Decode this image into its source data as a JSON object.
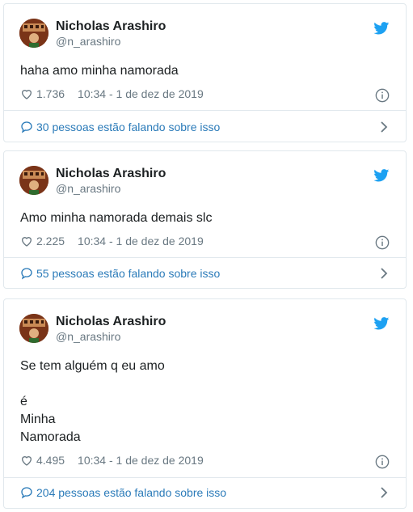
{
  "tweets": [
    {
      "name": "Nicholas Arashiro",
      "handle": "@n_arashiro",
      "lines": [
        "haha amo minha namorada"
      ],
      "likes": "1.736",
      "timestamp": "10:34 - 1 de dez de 2019",
      "conversation": "30 pessoas estão falando sobre isso"
    },
    {
      "name": "Nicholas Arashiro",
      "handle": "@n_arashiro",
      "lines": [
        "Amo minha namorada demais slc"
      ],
      "likes": "2.225",
      "timestamp": "10:34 - 1 de dez de 2019",
      "conversation": "55 pessoas estão falando sobre isso"
    },
    {
      "name": "Nicholas Arashiro",
      "handle": "@n_arashiro",
      "lines": [
        "Se tem alguém q eu amo",
        "",
        "é",
        "Minha",
        "Namorada"
      ],
      "likes": "4.495",
      "timestamp": "10:34 - 1 de dez de 2019",
      "conversation": "204 pessoas estão falando sobre isso"
    }
  ],
  "colors": {
    "brand": "#1da1f2",
    "link": "#2b7bb9",
    "muted": "#697882",
    "border": "#e1e8ed"
  },
  "icons": [
    "twitter-bird-icon",
    "heart-icon",
    "info-icon",
    "speech-bubble-icon",
    "chevron-right-icon"
  ]
}
